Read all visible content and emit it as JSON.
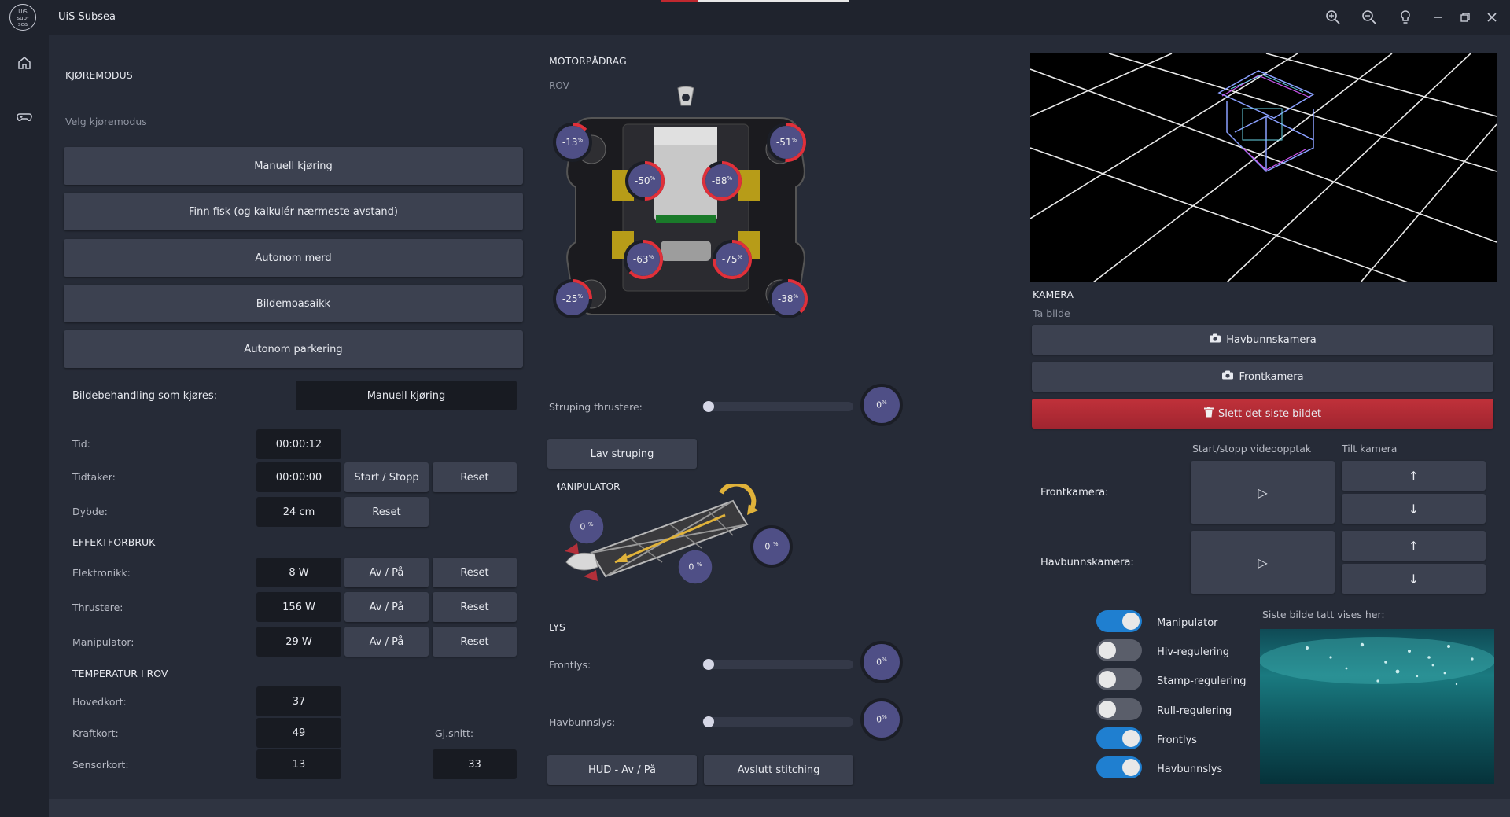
{
  "app": {
    "title": "UiS Subsea",
    "logo_text": "UiS sub- sea"
  },
  "titlebar_icons": [
    "zoom-in-icon",
    "zoom-out-icon",
    "lightbulb-icon",
    "minimize-icon",
    "restore-icon",
    "close-icon"
  ],
  "sidebar": [
    "home-icon",
    "gamepad-icon"
  ],
  "drive": {
    "title": "KJØREMODUS",
    "subtitle": "Velg kjøremodus",
    "modes": [
      "Manuell kjøring",
      "Finn fisk (og kalkulér nærmeste avstand)",
      "Autonom merd",
      "Bildemoasaikk",
      "Autonom parkering"
    ],
    "processing_label": "Bildebehandling som kjøres:",
    "processing_value": "Manuell kjøring"
  },
  "timers": {
    "time_label": "Tid:",
    "time_value": "00:00:12",
    "stopwatch_label": "Tidtaker:",
    "stopwatch_value": "00:00:00",
    "startstop": "Start / Stopp",
    "reset": "Reset",
    "depth_label": "Dybde:",
    "depth_value": "24 cm",
    "depth_reset": "Reset"
  },
  "power": {
    "title": "EFFEKTFORBRUK",
    "rows": [
      {
        "label": "Elektronikk:",
        "value": "8 W",
        "toggle": "Av / På",
        "reset": "Reset"
      },
      {
        "label": "Thrustere:",
        "value": "156 W",
        "toggle": "Av / På",
        "reset": "Reset"
      },
      {
        "label": "Manipulator:",
        "value": "29 W",
        "toggle": "Av / På",
        "reset": "Reset"
      }
    ]
  },
  "temp": {
    "title": "TEMPERATUR I ROV",
    "rows": [
      {
        "label": "Hovedkort:",
        "value": "37"
      },
      {
        "label": "Kraftkort:",
        "value": "49"
      },
      {
        "label": "Sensorkort:",
        "value": "13"
      }
    ],
    "avg_label": "Gj.snitt:",
    "avg_value": "33"
  },
  "motor": {
    "title": "MOTORPÅDRAG",
    "rov_label": "ROV",
    "thrusters": [
      {
        "value": "-13",
        "frac": 0.13
      },
      {
        "value": "-51",
        "frac": 0.51
      },
      {
        "value": "-50",
        "frac": 0.5
      },
      {
        "value": "-88",
        "frac": 0.88
      },
      {
        "value": "-63",
        "frac": 0.63
      },
      {
        "value": "-75",
        "frac": 0.75
      },
      {
        "value": "-25",
        "frac": 0.25
      },
      {
        "value": "-38",
        "frac": 0.38
      }
    ],
    "pct": "%",
    "throttle_label": "Struping thrustere:",
    "throttle_value": "0",
    "throttle_button": "Lav struping"
  },
  "manipulator": {
    "title": "MANIPULATOR",
    "values": [
      "0",
      "0",
      "0"
    ]
  },
  "lights": {
    "title": "LYS",
    "front_label": "Frontlys:",
    "front_value": "0",
    "bottom_label": "Havbunnslys:",
    "bottom_value": "0",
    "hud_button": "HUD - Av / På",
    "stitch_button": "Avslutt stitching"
  },
  "camera": {
    "title": "KAMERA",
    "subtitle": "Ta bilde",
    "buttons": [
      "Havbunnskamera",
      "Frontkamera"
    ],
    "delete_button": "Slett det siste bildet",
    "record_header": "Start/stopp videoopptak",
    "tilt_header": "Tilt kamera",
    "front_label": "Frontkamera:",
    "bottom_label": "Havbunnskamera:",
    "play_glyph": "▷",
    "up_glyph": "↑",
    "down_glyph": "↓"
  },
  "toggles": [
    {
      "label": "Manipulator",
      "on": true
    },
    {
      "label": "Hiv-regulering",
      "on": false
    },
    {
      "label": "Stamp-regulering",
      "on": false
    },
    {
      "label": "Rull-regulering",
      "on": false
    },
    {
      "label": "Frontlys",
      "on": true
    },
    {
      "label": "Havbunnslys",
      "on": true
    }
  ],
  "last_image_label": "Siste bilde tatt vises her:",
  "colors": {
    "accent_red": "#e0303a",
    "toggle_on": "#1f7fd0",
    "thruster_fill": "#4f4f86"
  }
}
